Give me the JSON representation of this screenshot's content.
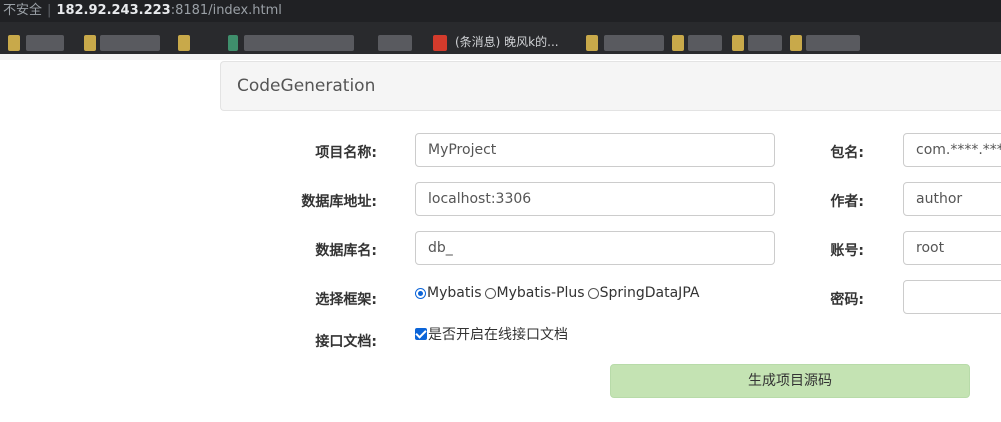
{
  "browser": {
    "insecure_label": "不安全",
    "url_host": "182.92.243.223",
    "url_rest": ":8181/index.html",
    "bookmark_visible_text": "(条消息) 晚风k的..."
  },
  "panel": {
    "title": "CodeGeneration"
  },
  "form": {
    "project_name": {
      "label": "项目名称:",
      "value": "MyProject"
    },
    "db_address": {
      "label": "数据库地址:",
      "value": "localhost:3306"
    },
    "db_name": {
      "label": "数据库名:",
      "value": "db_"
    },
    "framework": {
      "label": "选择框架:",
      "options": [
        "Mybatis",
        "Mybatis-Plus",
        "SpringDataJPA"
      ],
      "selected": "Mybatis"
    },
    "api_doc": {
      "label": "接口文档:",
      "checkbox_label": "是否开启在线接口文档",
      "checked": true
    },
    "package": {
      "label": "包名:",
      "value": "com.****.****"
    },
    "author": {
      "label": "作者:",
      "value": "author"
    },
    "account": {
      "label": "账号:",
      "value": "root"
    },
    "password": {
      "label": "密码:",
      "value": ""
    }
  },
  "generate_button": {
    "label": "生成项目源码"
  },
  "colors": {
    "button_bg": "#c4e3b3",
    "control_accent": "#0b64d8",
    "address_bar_bg": "#202124"
  }
}
